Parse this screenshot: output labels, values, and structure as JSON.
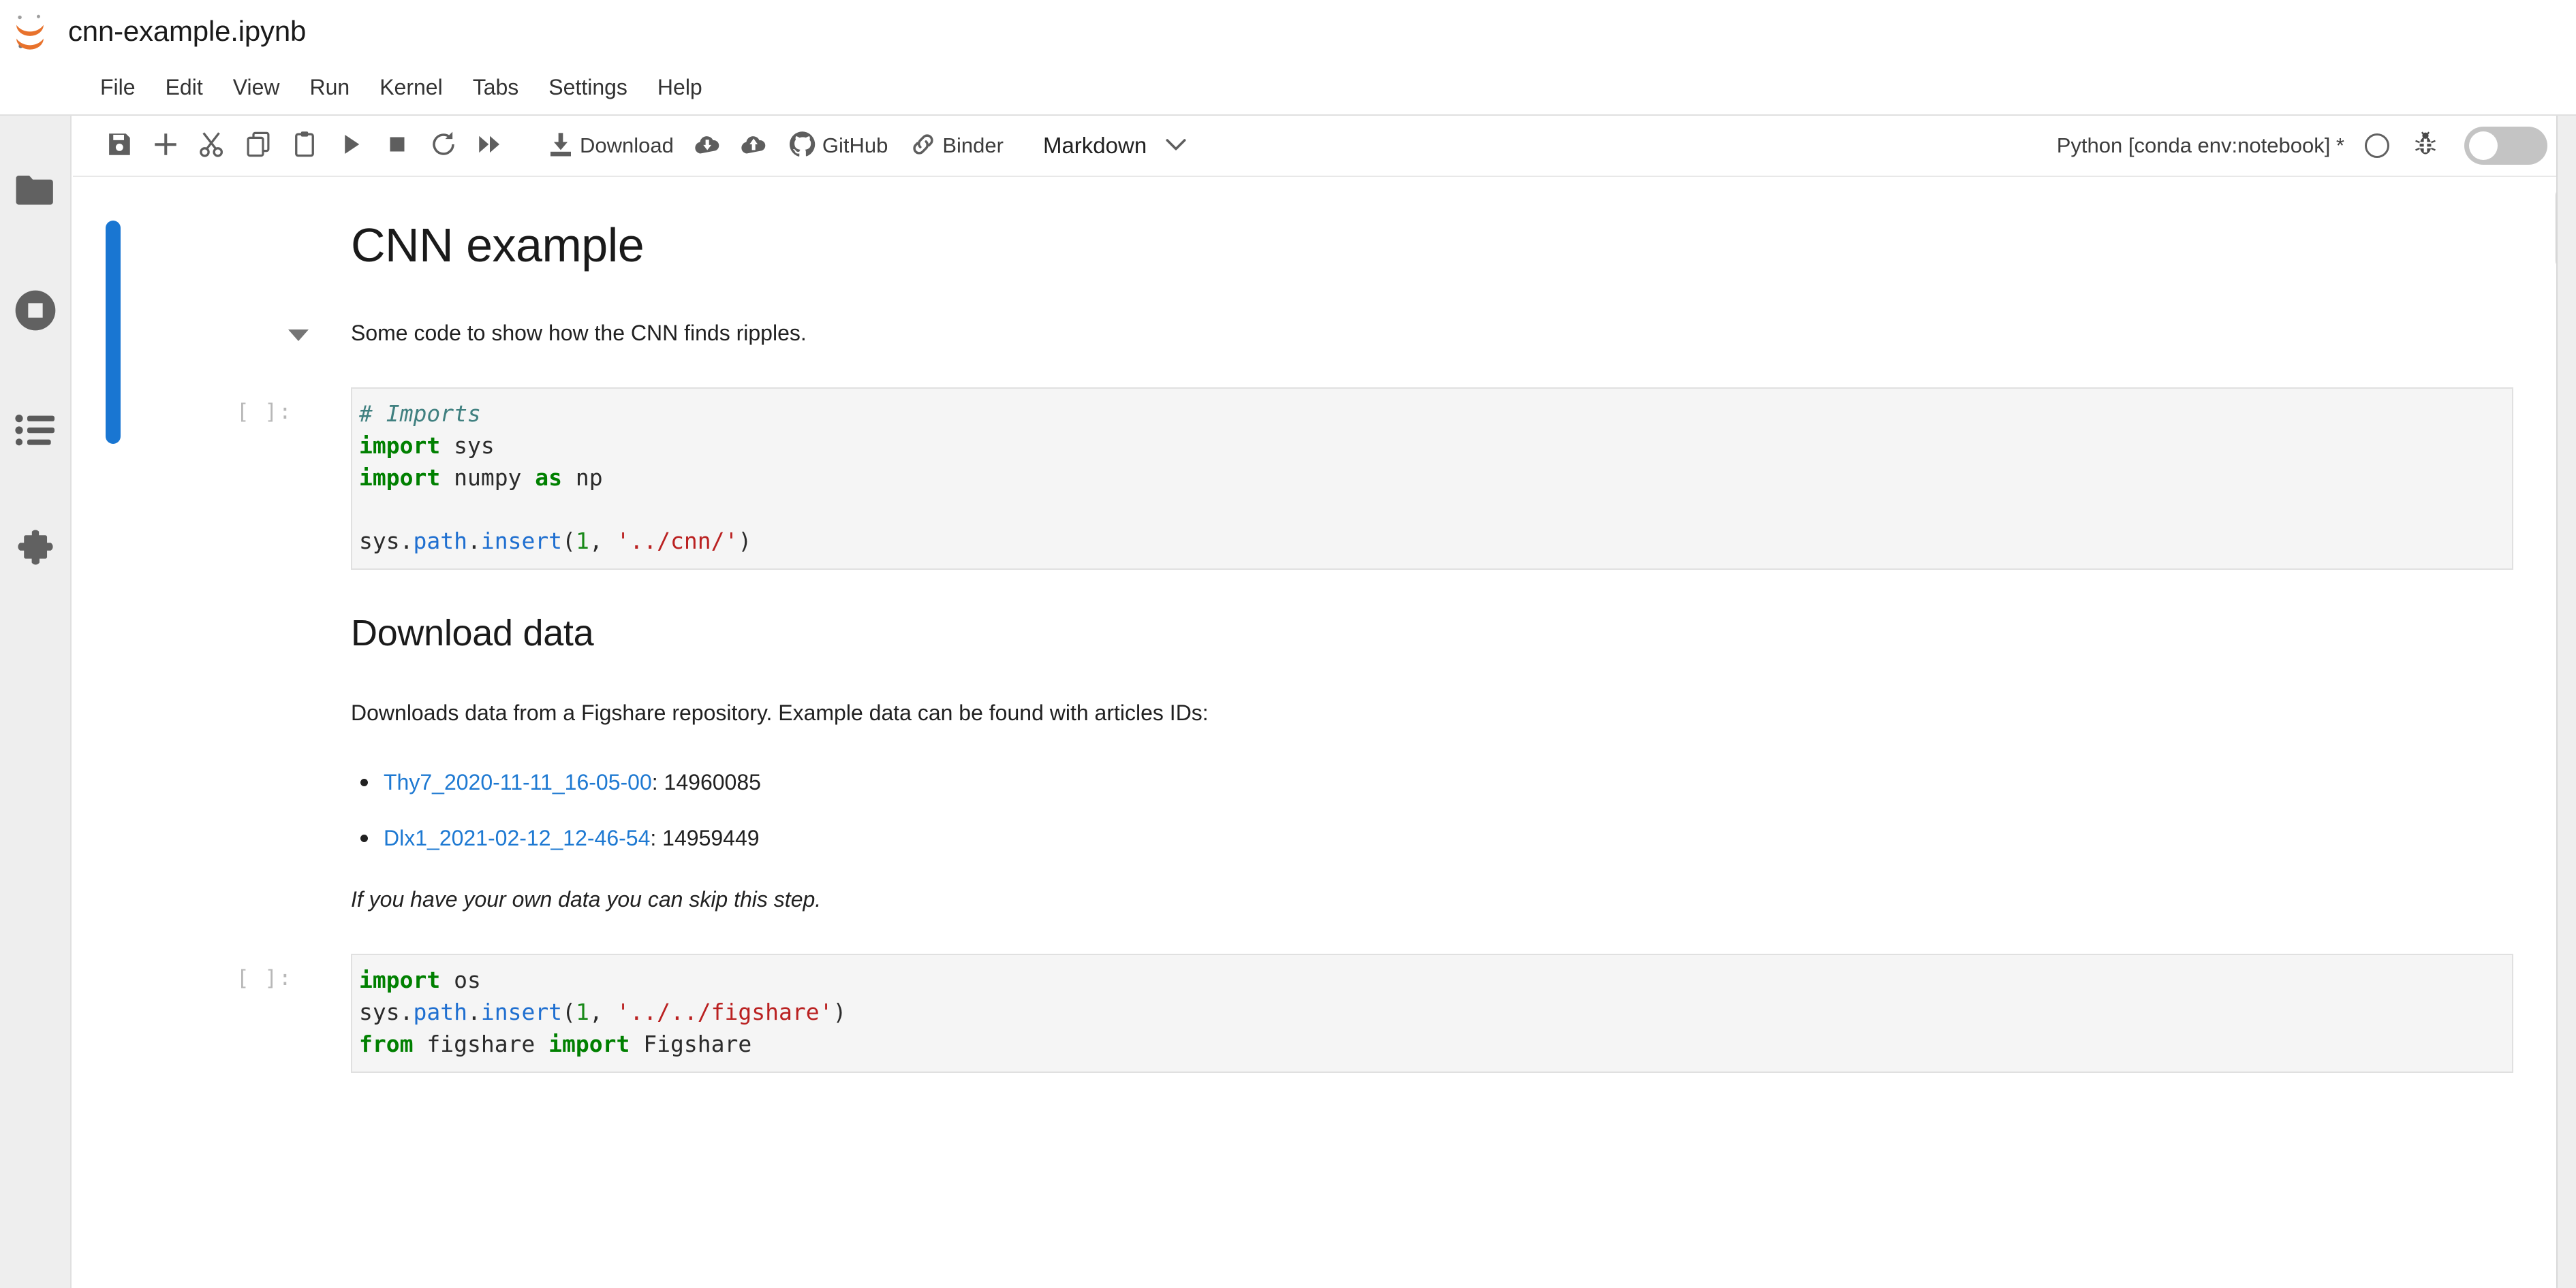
{
  "app": {
    "logo_icon": "jupyter-logo-icon",
    "document_title": "cnn-example.ipynb"
  },
  "menubar": {
    "items": [
      {
        "label": "File"
      },
      {
        "label": "Edit"
      },
      {
        "label": "View"
      },
      {
        "label": "Run"
      },
      {
        "label": "Kernel"
      },
      {
        "label": "Tabs"
      },
      {
        "label": "Settings"
      },
      {
        "label": "Help"
      }
    ]
  },
  "sidebar": {
    "items": [
      {
        "name": "file-browser",
        "icon": "folder-icon"
      },
      {
        "name": "running-sessions",
        "icon": "stop-circle-icon"
      },
      {
        "name": "table-of-contents",
        "icon": "list-icon"
      },
      {
        "name": "extension-manager",
        "icon": "puzzle-piece-icon"
      }
    ]
  },
  "toolbar": {
    "buttons": [
      {
        "name": "save",
        "icon": "save-icon",
        "label": ""
      },
      {
        "name": "insert-cell",
        "icon": "plus-icon",
        "label": ""
      },
      {
        "name": "cut-cell",
        "icon": "scissors-icon",
        "label": ""
      },
      {
        "name": "copy-cell",
        "icon": "copy-icon",
        "label": ""
      },
      {
        "name": "paste-cell",
        "icon": "clipboard-icon",
        "label": ""
      },
      {
        "name": "run-cell",
        "icon": "play-icon",
        "label": ""
      },
      {
        "name": "interrupt-kernel",
        "icon": "stop-square-icon",
        "label": ""
      },
      {
        "name": "restart-kernel",
        "icon": "restart-icon",
        "label": ""
      },
      {
        "name": "restart-run-all",
        "icon": "fast-forward-icon",
        "label": ""
      }
    ],
    "download_label": "Download",
    "download_icon": "download-icon",
    "cloud_download_icon": "cloud-download-icon",
    "cloud_upload_icon": "cloud-upload-icon",
    "github_label": "GitHub",
    "github_icon": "github-icon",
    "binder_label": "Binder",
    "binder_icon": "link-icon",
    "celltype_value": "Markdown",
    "celltype_caret_icon": "chevron-down-icon",
    "kernel_name": "Python [conda env:notebook] *",
    "kernel_status_icon": "kernel-idle-circle-icon",
    "debugger_icon": "bug-icon",
    "debugger_toggle_state": "off"
  },
  "notebook": {
    "cells": [
      {
        "type": "markdown",
        "name": "markdown-cell-intro",
        "active": true,
        "heading": "CNN example",
        "paragraph": "Some code to show how the CNN finds ripples."
      },
      {
        "type": "code",
        "name": "code-cell-imports",
        "prompt": "[ ]:",
        "lines": [
          [
            {
              "t": "# Imports",
              "c": "cm-comment"
            }
          ],
          [
            {
              "t": "import",
              "c": "cm-keyword"
            },
            {
              "t": " sys",
              "c": "cm-plain"
            }
          ],
          [
            {
              "t": "import",
              "c": "cm-keyword"
            },
            {
              "t": " numpy ",
              "c": "cm-plain"
            },
            {
              "t": "as",
              "c": "cm-keyword"
            },
            {
              "t": " np",
              "c": "cm-plain"
            }
          ],
          [
            {
              "t": "",
              "c": "cm-plain"
            }
          ],
          [
            {
              "t": "sys.",
              "c": "cm-plain"
            },
            {
              "t": "path",
              "c": "cm-builtin"
            },
            {
              "t": ".",
              "c": "cm-plain"
            },
            {
              "t": "insert",
              "c": "cm-builtin"
            },
            {
              "t": "(",
              "c": "cm-plain"
            },
            {
              "t": "1",
              "c": "cm-number"
            },
            {
              "t": ", ",
              "c": "cm-plain"
            },
            {
              "t": "'../cnn/'",
              "c": "cm-string"
            },
            {
              "t": ")",
              "c": "cm-plain"
            }
          ]
        ]
      },
      {
        "type": "markdown",
        "name": "markdown-cell-download-data",
        "active": false,
        "heading": "Download data",
        "paragraph": "Downloads data from a Figshare repository. Example data can be found with articles IDs:",
        "list": [
          {
            "link_text": "Thy7_2020-11-11_16-05-00",
            "value": ": 14960085"
          },
          {
            "link_text": "Dlx1_2021-02-12_12-46-54",
            "value": ": 14959449"
          }
        ],
        "note": "If you have your own data you can skip this step."
      },
      {
        "type": "code",
        "name": "code-cell-figshare",
        "prompt": "[ ]:",
        "lines": [
          [
            {
              "t": "import",
              "c": "cm-keyword"
            },
            {
              "t": " os",
              "c": "cm-plain"
            }
          ],
          [
            {
              "t": "sys.",
              "c": "cm-plain"
            },
            {
              "t": "path",
              "c": "cm-builtin"
            },
            {
              "t": ".",
              "c": "cm-plain"
            },
            {
              "t": "insert",
              "c": "cm-builtin"
            },
            {
              "t": "(",
              "c": "cm-plain"
            },
            {
              "t": "1",
              "c": "cm-number"
            },
            {
              "t": ", ",
              "c": "cm-plain"
            },
            {
              "t": "'../../figshare'",
              "c": "cm-string"
            },
            {
              "t": ")",
              "c": "cm-plain"
            }
          ],
          [
            {
              "t": "from",
              "c": "cm-keyword"
            },
            {
              "t": " figshare ",
              "c": "cm-plain"
            },
            {
              "t": "import",
              "c": "cm-keyword"
            },
            {
              "t": " Figshare",
              "c": "cm-plain"
            }
          ]
        ]
      }
    ]
  },
  "colors": {
    "active_cell_bar": "#1976d2",
    "link": "#1e79d2",
    "code_background": "#f5f5f5",
    "sidebar_background": "#eeeeee",
    "keyword": "#008000",
    "string": "#ba2121",
    "comment": "#408080",
    "builtin": "#1f6fd0"
  },
  "scrollbar": {
    "name": "notebook-vertical-scrollbar"
  }
}
